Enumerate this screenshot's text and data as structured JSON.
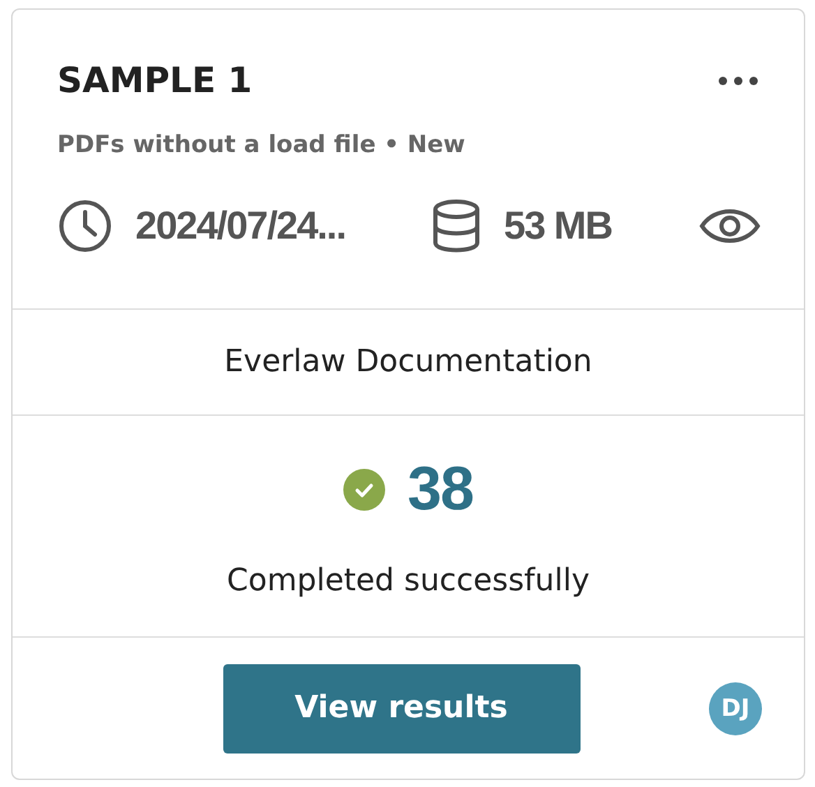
{
  "card": {
    "title": "SAMPLE 1",
    "subtitle": "PDFs without a load file • New",
    "date": "2024/07/24...",
    "size": "53 MB",
    "source": "Everlaw Documentation",
    "completed": true,
    "count": "38",
    "status_text": "Completed successfully",
    "button": "View results",
    "avatar": "DJ"
  }
}
